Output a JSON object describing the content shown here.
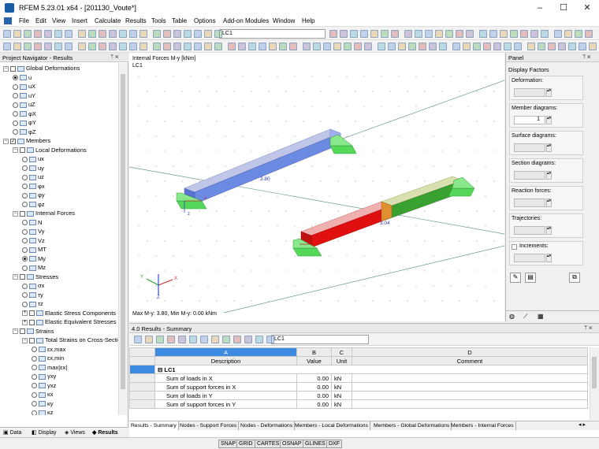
{
  "window": {
    "title": "RFEM 5.23.01 x64 - [201130_Voute*]",
    "minimize": "–",
    "maximize": "☐",
    "close": "✕"
  },
  "menu": [
    "File",
    "Edit",
    "View",
    "Insert",
    "Calculate",
    "Results",
    "Tools",
    "Table",
    "Options",
    "Add-on Modules",
    "Window",
    "Help"
  ],
  "toolbar": {
    "loadcase": "LC1"
  },
  "navigator": {
    "title": "Project Navigator - Results",
    "items": [
      {
        "label": "Global Deformations",
        "level": 1,
        "kind": "check",
        "exp": "−"
      },
      {
        "label": "u",
        "level": 2,
        "kind": "radio",
        "on": true
      },
      {
        "label": "uX",
        "level": 2,
        "kind": "radio"
      },
      {
        "label": "uY",
        "level": 2,
        "kind": "radio"
      },
      {
        "label": "uZ",
        "level": 2,
        "kind": "radio"
      },
      {
        "label": "φX",
        "level": 2,
        "kind": "radio"
      },
      {
        "label": "φY",
        "level": 2,
        "kind": "radio"
      },
      {
        "label": "φZ",
        "level": 2,
        "kind": "radio"
      },
      {
        "label": "Members",
        "level": 1,
        "kind": "checked",
        "exp": "−"
      },
      {
        "label": "Local Deformations",
        "level": 2,
        "kind": "check",
        "exp": "−"
      },
      {
        "label": "ux",
        "level": 3,
        "kind": "radio"
      },
      {
        "label": "uy",
        "level": 3,
        "kind": "radio"
      },
      {
        "label": "uz",
        "level": 3,
        "kind": "radio"
      },
      {
        "label": "φx",
        "level": 3,
        "kind": "radio"
      },
      {
        "label": "φy",
        "level": 3,
        "kind": "radio"
      },
      {
        "label": "φz",
        "level": 3,
        "kind": "radio"
      },
      {
        "label": "Internal Forces",
        "level": 2,
        "kind": "check",
        "exp": "−"
      },
      {
        "label": "N",
        "level": 3,
        "kind": "radio"
      },
      {
        "label": "Vy",
        "level": 3,
        "kind": "radio"
      },
      {
        "label": "Vz",
        "level": 3,
        "kind": "radio"
      },
      {
        "label": "MT",
        "level": 3,
        "kind": "radio"
      },
      {
        "label": "My",
        "level": 3,
        "kind": "radio",
        "on": true
      },
      {
        "label": "Mz",
        "level": 3,
        "kind": "radio"
      },
      {
        "label": "Stresses",
        "level": 2,
        "kind": "check",
        "exp": "−"
      },
      {
        "label": "σx",
        "level": 3,
        "kind": "radio"
      },
      {
        "label": "τy",
        "level": 3,
        "kind": "radio"
      },
      {
        "label": "τz",
        "level": 3,
        "kind": "radio"
      },
      {
        "label": "Elastic Stress Components",
        "level": 3,
        "kind": "check",
        "exp": "+"
      },
      {
        "label": "Elastic Equivalent Stresses",
        "level": 3,
        "kind": "check",
        "exp": "+"
      },
      {
        "label": "Strains",
        "level": 2,
        "kind": "check",
        "exp": "−"
      },
      {
        "label": "Total Strains on Cross-Section",
        "level": 3,
        "kind": "check",
        "exp": "−"
      },
      {
        "label": "εx,max",
        "level": 4,
        "kind": "radio"
      },
      {
        "label": "εx,min",
        "level": 4,
        "kind": "radio"
      },
      {
        "label": "max|εx|",
        "level": 4,
        "kind": "radio"
      },
      {
        "label": "γxy",
        "level": 4,
        "kind": "radio"
      },
      {
        "label": "γxz",
        "level": 4,
        "kind": "radio"
      },
      {
        "label": "κx",
        "level": 4,
        "kind": "radio"
      },
      {
        "label": "κy",
        "level": 4,
        "kind": "radio"
      },
      {
        "label": "κz",
        "level": 4,
        "kind": "radio"
      }
    ],
    "tabs": [
      "Data",
      "Display",
      "Views",
      "Results"
    ]
  },
  "view": {
    "label1": "Internal Forces M-y [kNm]",
    "label2": "LC1",
    "bottom": "Max M-y: 3.80, Min M-y: 0.00 kNm",
    "val1": "3.80",
    "val2": "3.04",
    "axis_x": "X",
    "axis_y": "Y",
    "axis_z": "Z",
    "loc_x": "x",
    "loc_z": "z"
  },
  "panel": {
    "title": "Panel",
    "heading": "Display Factors",
    "groups": [
      "Deformation:",
      "Member diagrams:",
      "Surface diagrams:",
      "Section diagrams:",
      "Reaction forces:",
      "Trajectories:",
      "Increments:"
    ],
    "member_value": "1"
  },
  "results": {
    "title": "4.0 Results - Summary",
    "loadcase": "LC1",
    "col_letters": [
      "A",
      "B",
      "C",
      "D"
    ],
    "headers": [
      "Description",
      "Value",
      "Unit",
      "Comment"
    ],
    "group": "LC1",
    "rows": [
      {
        "desc": "Sum of loads in X",
        "value": "0.00",
        "unit": "kN"
      },
      {
        "desc": "Sum of support forces in X",
        "value": "0.00",
        "unit": "kN"
      },
      {
        "desc": "Sum of loads in Y",
        "value": "0.00",
        "unit": "kN"
      },
      {
        "desc": "Sum of support forces in Y",
        "value": "0.00",
        "unit": "kN"
      }
    ],
    "tabs": [
      "Results - Summary",
      "Nodes - Support Forces",
      "Nodes - Deformations",
      "Members - Local Deformations",
      "Members - Global Deformations",
      "Members - Internal Forces"
    ]
  },
  "status": [
    "SNAP",
    "GRID",
    "CARTES",
    "OSNAP",
    "GLINES",
    "DXF"
  ]
}
